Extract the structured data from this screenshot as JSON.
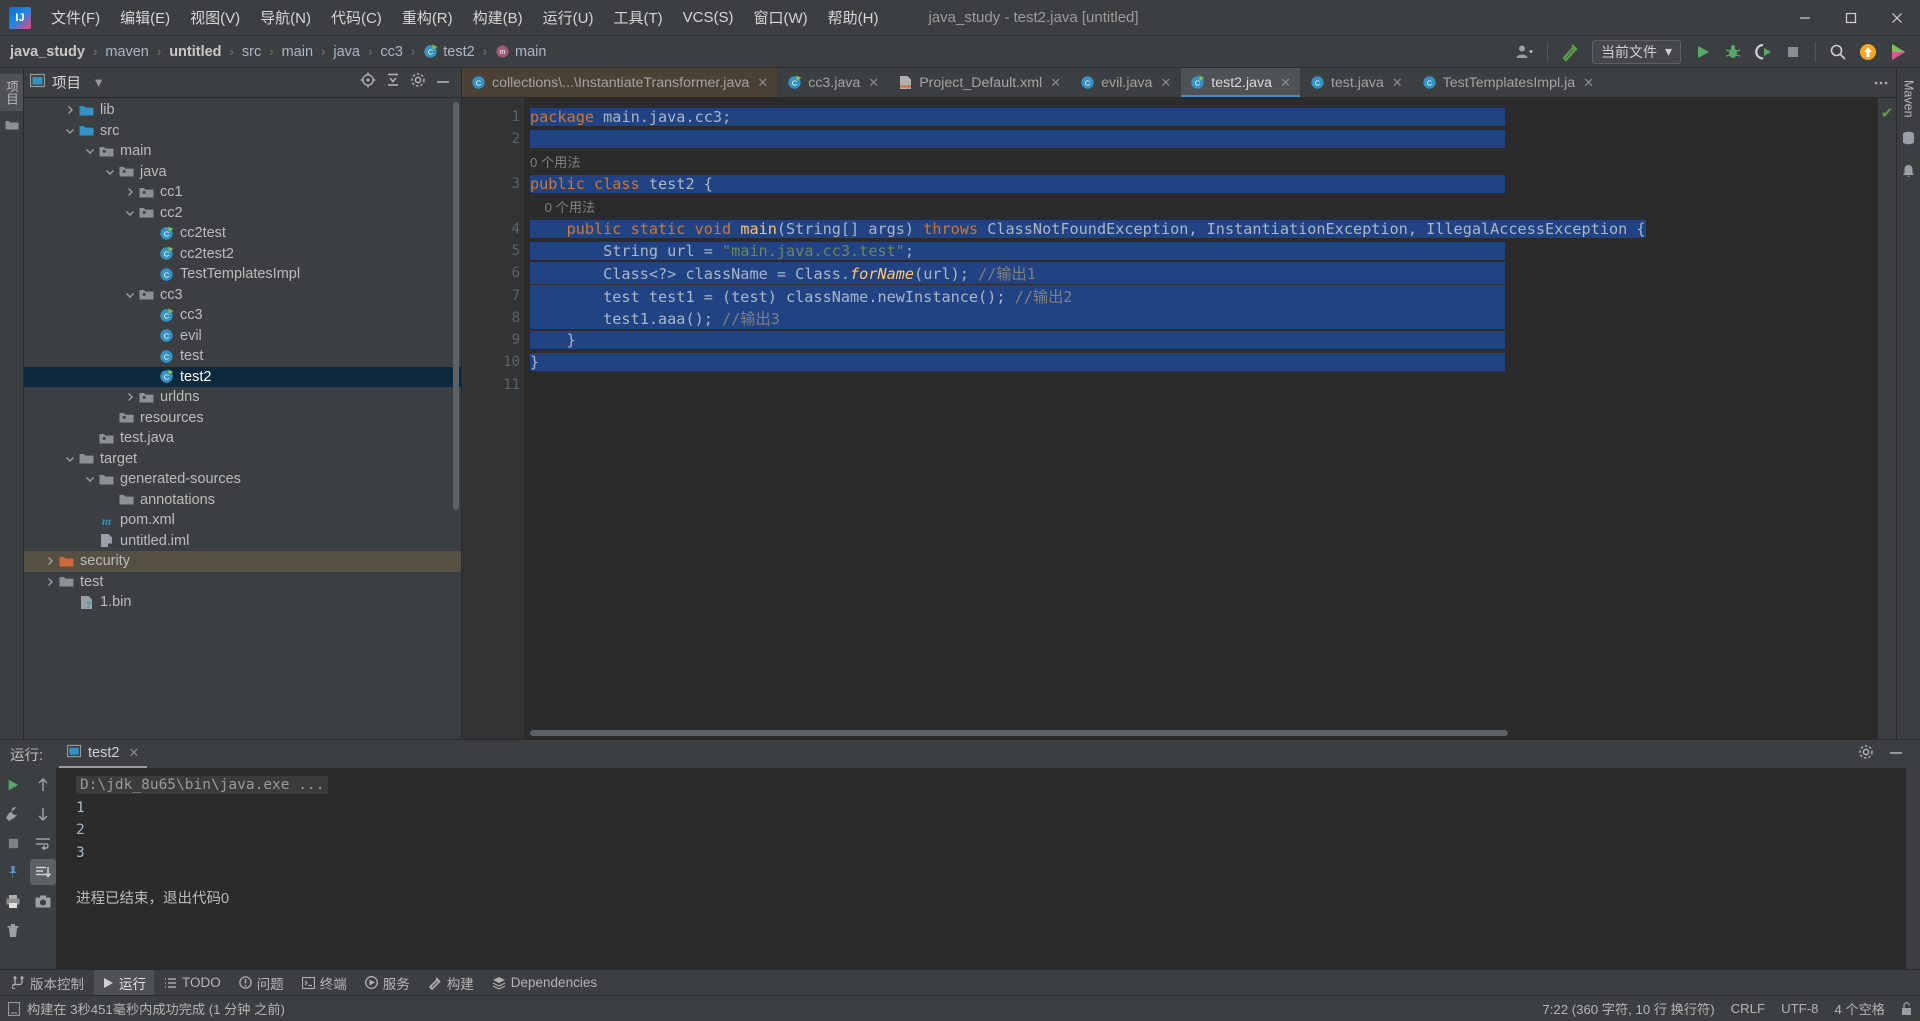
{
  "window": {
    "title": "java_study - test2.java [untitled]",
    "logo_text": "IJ",
    "minimize": "—",
    "maximize": "❐",
    "close": "✕"
  },
  "menubar": {
    "items": [
      {
        "label": "文件(F)",
        "name": "menu-file"
      },
      {
        "label": "编辑(E)",
        "name": "menu-edit"
      },
      {
        "label": "视图(V)",
        "name": "menu-view"
      },
      {
        "label": "导航(N)",
        "name": "menu-navigate"
      },
      {
        "label": "代码(C)",
        "name": "menu-code"
      },
      {
        "label": "重构(R)",
        "name": "menu-refactor"
      },
      {
        "label": "构建(B)",
        "name": "menu-build"
      },
      {
        "label": "运行(U)",
        "name": "menu-run"
      },
      {
        "label": "工具(T)",
        "name": "menu-tools"
      },
      {
        "label": "VCS(S)",
        "name": "menu-vcs"
      },
      {
        "label": "窗口(W)",
        "name": "menu-window"
      },
      {
        "label": "帮助(H)",
        "name": "menu-help"
      }
    ]
  },
  "breadcrumbs": {
    "items": [
      {
        "label": "java_study",
        "bold": true,
        "icon": ""
      },
      {
        "label": "maven",
        "bold": false,
        "icon": ""
      },
      {
        "label": "untitled",
        "bold": true,
        "icon": ""
      },
      {
        "label": "src",
        "bold": false,
        "icon": ""
      },
      {
        "label": "main",
        "bold": false,
        "icon": ""
      },
      {
        "label": "java",
        "bold": false,
        "icon": ""
      },
      {
        "label": "cc3",
        "bold": false,
        "icon": ""
      },
      {
        "label": "test2",
        "bold": false,
        "icon": "class-runnable-icon"
      },
      {
        "label": "main",
        "bold": false,
        "icon": "method-icon"
      }
    ],
    "separator": "›"
  },
  "toolbar": {
    "run_config_label": "当前文件",
    "dropdown_caret": "▾",
    "icons": [
      "user-dropdown-icon",
      "build-hammer-icon",
      "run-icon",
      "debug-icon",
      "run-coverage-icon",
      "stop-icon",
      "search-icon",
      "update-icon",
      "idea-feature-icon"
    ]
  },
  "project_panel": {
    "title": "项目",
    "caret": "▾",
    "header_icons": [
      "locate-icon",
      "collapse-all-icon",
      "settings-icon",
      "hide-icon"
    ],
    "tree": [
      {
        "label": "lib",
        "depth": 3,
        "twist": "›",
        "icon": "folder-blue",
        "state": ""
      },
      {
        "label": "src",
        "depth": 3,
        "twist": "⌄",
        "icon": "folder-blue",
        "state": ""
      },
      {
        "label": "main",
        "depth": 4,
        "twist": "⌄",
        "icon": "folder-module",
        "state": ""
      },
      {
        "label": "java",
        "depth": 5,
        "twist": "⌄",
        "icon": "folder-source",
        "state": ""
      },
      {
        "label": "cc1",
        "depth": 6,
        "twist": "›",
        "icon": "folder-source",
        "state": ""
      },
      {
        "label": "cc2",
        "depth": 6,
        "twist": "⌄",
        "icon": "folder-source",
        "state": ""
      },
      {
        "label": "cc2test",
        "depth": 7,
        "twist": "",
        "icon": "class-runnable",
        "state": ""
      },
      {
        "label": "cc2test2",
        "depth": 7,
        "twist": "",
        "icon": "class-runnable",
        "state": ""
      },
      {
        "label": "TestTemplatesImpl",
        "depth": 7,
        "twist": "",
        "icon": "class",
        "state": ""
      },
      {
        "label": "cc3",
        "depth": 6,
        "twist": "⌄",
        "icon": "folder-source",
        "state": ""
      },
      {
        "label": "cc3",
        "depth": 7,
        "twist": "",
        "icon": "class-runnable",
        "state": ""
      },
      {
        "label": "evil",
        "depth": 7,
        "twist": "",
        "icon": "class",
        "state": ""
      },
      {
        "label": "test",
        "depth": 7,
        "twist": "",
        "icon": "class",
        "state": ""
      },
      {
        "label": "test2",
        "depth": 7,
        "twist": "",
        "icon": "class-runnable",
        "state": "selected"
      },
      {
        "label": "urldns",
        "depth": 6,
        "twist": "›",
        "icon": "folder-source",
        "state": ""
      },
      {
        "label": "resources",
        "depth": 5,
        "twist": "",
        "icon": "folder-resource",
        "state": ""
      },
      {
        "label": "test.java",
        "depth": 4,
        "twist": "",
        "icon": "folder-test",
        "state": ""
      },
      {
        "label": "target",
        "depth": 3,
        "twist": "⌄",
        "icon": "folder-gray",
        "state": ""
      },
      {
        "label": "generated-sources",
        "depth": 4,
        "twist": "⌄",
        "icon": "folder-gray",
        "state": ""
      },
      {
        "label": "annotations",
        "depth": 5,
        "twist": "",
        "icon": "folder-gray",
        "state": ""
      },
      {
        "label": "pom.xml",
        "depth": 4,
        "twist": "",
        "icon": "maven",
        "state": ""
      },
      {
        "label": "untitled.iml",
        "depth": 4,
        "twist": "",
        "icon": "iml",
        "state": ""
      },
      {
        "label": "security",
        "depth": 2,
        "twist": "›",
        "icon": "folder-orange",
        "state": "highlight"
      },
      {
        "label": "test",
        "depth": 2,
        "twist": "›",
        "icon": "folder-gray",
        "state": ""
      },
      {
        "label": "1.bin",
        "depth": 3,
        "twist": "",
        "icon": "unknown-file",
        "state": ""
      }
    ]
  },
  "editor": {
    "tabs": [
      {
        "label": "collections\\...\\InstantiateTransformer.java",
        "icon": "class",
        "state": "modified"
      },
      {
        "label": "cc3.java",
        "icon": "class-runnable",
        "state": "plain"
      },
      {
        "label": "Project_Default.xml",
        "icon": "xml",
        "state": "plain"
      },
      {
        "label": "evil.java",
        "icon": "class",
        "state": "plain"
      },
      {
        "label": "test2.java",
        "icon": "class-runnable",
        "state": "active"
      },
      {
        "label": "test.java",
        "icon": "class",
        "state": "plain"
      },
      {
        "label": "TestTemplatesImpl.ja",
        "icon": "class",
        "state": "plain"
      }
    ],
    "tab_close": "✕",
    "tabs_overflow_icon": "more-tabs-icon",
    "inspection_ok": "✔",
    "lines": [
      {
        "num": "1",
        "marker": "",
        "selected": true,
        "tokens": [
          {
            "t": "package ",
            "c": "kw"
          },
          {
            "t": "main.java.cc3;",
            "c": "id"
          }
        ]
      },
      {
        "num": "2",
        "marker": "",
        "selected": true,
        "tokens": []
      },
      {
        "num": "",
        "marker": "",
        "selected": false,
        "hint": "0 个用法"
      },
      {
        "num": "3",
        "marker": "run",
        "selected": true,
        "tokens": [
          {
            "t": "public class ",
            "c": "kw"
          },
          {
            "t": "test2 {",
            "c": "id"
          }
        ]
      },
      {
        "num": "",
        "marker": "",
        "selected": false,
        "hint": "    0 个用法"
      },
      {
        "num": "4",
        "marker": "run",
        "selected": true,
        "tokens": [
          {
            "t": "    public static void ",
            "c": "kw"
          },
          {
            "t": "main",
            "c": "mth"
          },
          {
            "t": "(String[] args) ",
            "c": "id"
          },
          {
            "t": "throws ",
            "c": "kw"
          },
          {
            "t": "ClassNotFoundException, InstantiationException, IllegalAccessException {",
            "c": "id"
          }
        ]
      },
      {
        "num": "5",
        "marker": "",
        "selected": true,
        "tokens": [
          {
            "t": "        String url = ",
            "c": "id"
          },
          {
            "t": "\"main.java.cc3.test\"",
            "c": "str"
          },
          {
            "t": ";",
            "c": "id"
          }
        ]
      },
      {
        "num": "6",
        "marker": "",
        "selected": true,
        "tokens": [
          {
            "t": "        Class<?> className = Class.",
            "c": "id"
          },
          {
            "t": "forName",
            "c": "ital"
          },
          {
            "t": "(url); ",
            "c": "id"
          },
          {
            "t": "//输出1",
            "c": "cmt"
          }
        ]
      },
      {
        "num": "7",
        "marker": "bulb",
        "selected": true,
        "tokens": [
          {
            "t": "        test test1 = (test) className.newInstance(); ",
            "c": "id"
          },
          {
            "t": "//输出2",
            "c": "cmt"
          }
        ]
      },
      {
        "num": "8",
        "marker": "",
        "selected": true,
        "tokens": [
          {
            "t": "        test1.aaa(); ",
            "c": "id"
          },
          {
            "t": "//输出3",
            "c": "cmt"
          }
        ]
      },
      {
        "num": "9",
        "marker": "fold",
        "selected": true,
        "tokens": [
          {
            "t": "    }",
            "c": "id"
          }
        ]
      },
      {
        "num": "10",
        "marker": "",
        "selected": true,
        "tokens": [
          {
            "t": "}",
            "c": "id"
          }
        ]
      },
      {
        "num": "11",
        "marker": "",
        "selected": false,
        "tokens": []
      }
    ]
  },
  "right_strip": {
    "items": [
      "Maven",
      "数据库",
      "通知"
    ]
  },
  "left_strip": {
    "items": [
      "项目"
    ],
    "icons": [
      "structure-icon"
    ]
  },
  "run_panel": {
    "label": "运行:",
    "tab_label": "test2",
    "tab_close": "✕",
    "header_icons": [
      "settings-icon",
      "minimize-icon"
    ],
    "sidebar_icons": [
      "rerun-icon",
      "up-arrow-icon",
      "wrench-icon",
      "down-arrow-icon",
      "stop-icon",
      "soft-wrap-icon",
      "scroll-to-end-icon",
      "pin-icon",
      "print-icon",
      "camera-icon",
      "trash-icon"
    ],
    "console": [
      {
        "text": "D:\\jdk_8u65\\bin\\java.exe ...",
        "style": "cmd"
      },
      {
        "text": "1",
        "style": "num"
      },
      {
        "text": "2",
        "style": "num"
      },
      {
        "text": "3",
        "style": "num"
      },
      {
        "text": "",
        "style": "num"
      },
      {
        "text": "进程已结束，退出代码0",
        "style": "exit"
      }
    ]
  },
  "toolwindow_bar": {
    "items": [
      {
        "label": "版本控制",
        "icon": "vcs-icon",
        "active": false
      },
      {
        "label": "运行",
        "icon": "run-icon",
        "active": true
      },
      {
        "label": "TODO",
        "icon": "todo-icon",
        "active": false
      },
      {
        "label": "问题",
        "icon": "problems-icon",
        "active": false
      },
      {
        "label": "终端",
        "icon": "terminal-icon",
        "active": false
      },
      {
        "label": "服务",
        "icon": "services-icon",
        "active": false
      },
      {
        "label": "构建",
        "icon": "build-icon",
        "active": false
      },
      {
        "label": "Dependencies",
        "icon": "dependencies-icon",
        "active": false
      }
    ]
  },
  "statusbar": {
    "message": "构建在 3秒451毫秒内成功完成 (1 分钟 之前)",
    "caret": "7:22 (360 字符, 10 行 换行符)",
    "line_sep": "CRLF",
    "encoding": "UTF-8",
    "indent": "4 个空格",
    "lock_icon": "lock-open-icon"
  },
  "colors": {
    "accent_blue": "#4a88c7",
    "selection": "#214283",
    "keyword": "#cc7832",
    "string": "#6a8759",
    "comment": "#808080",
    "method": "#ffc66d",
    "tree_selected": "#0d293e",
    "highlight_row": "#565043"
  }
}
